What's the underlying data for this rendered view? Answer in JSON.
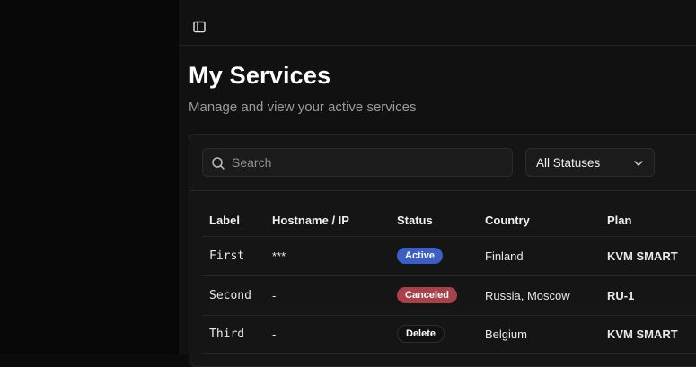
{
  "header": {
    "sidebar_toggle_icon": "sidebar-panel-icon"
  },
  "page": {
    "title": "My Services",
    "subtitle": "Manage and view your active services"
  },
  "filters": {
    "search": {
      "placeholder": "Search",
      "value": "",
      "icon": "search-icon"
    },
    "status": {
      "selected": "All Statuses",
      "icon": "chevron-down-icon"
    }
  },
  "table": {
    "columns": [
      "Label",
      "Hostname / IP",
      "Status",
      "Country",
      "Plan"
    ],
    "rows": [
      {
        "label": "First",
        "hostname": "***",
        "status": "Active",
        "country": "Finland",
        "plan": "KVM SMART"
      },
      {
        "label": "Second",
        "hostname": "-",
        "status": "Canceled",
        "country": "Russia, Moscow",
        "plan": "RU-1"
      },
      {
        "label": "Third",
        "hostname": "-",
        "status": "Delete",
        "country": "Belgium",
        "plan": "KVM SMART"
      }
    ]
  },
  "colors": {
    "status_active": "#3b5fc4",
    "status_canceled": "#a8424a",
    "status_delete": "#111111",
    "background": "#111111"
  }
}
